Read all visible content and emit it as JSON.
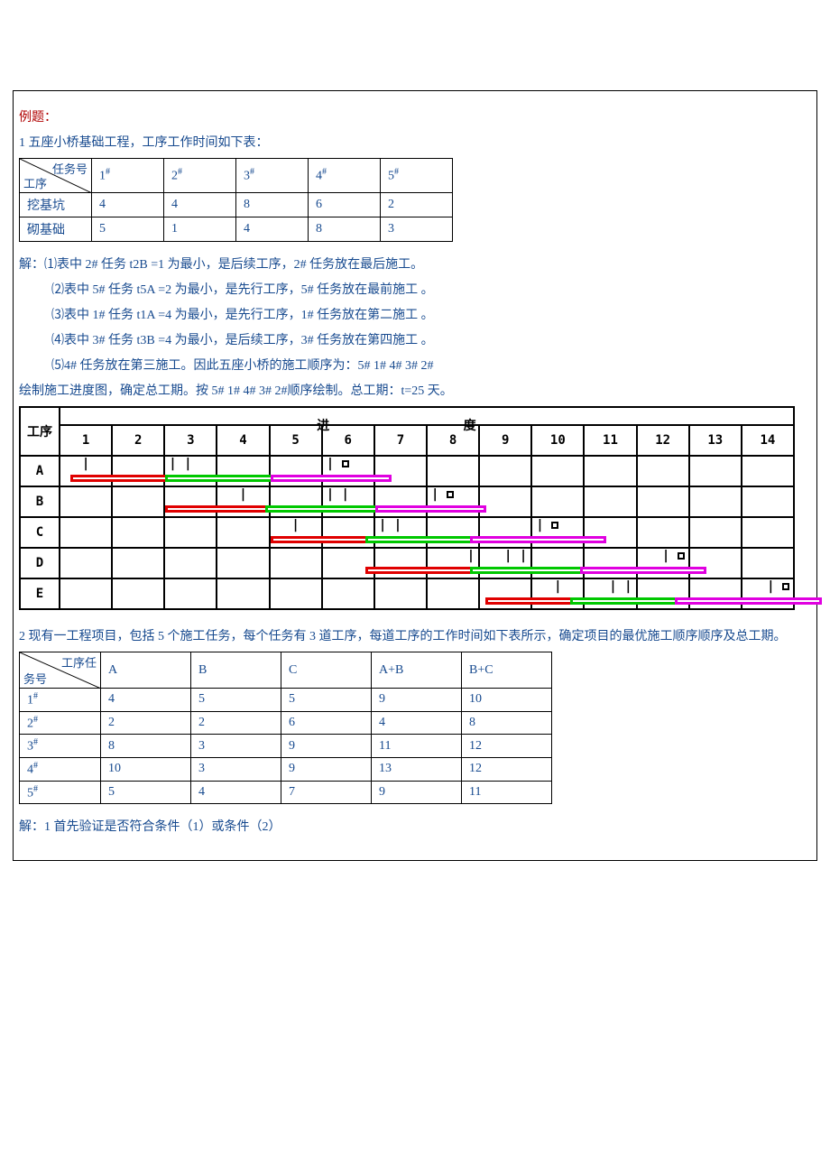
{
  "heading": "例题：",
  "p1_intro": "1 五座小桥基础工程，工序工作时间如下表：",
  "t1": {
    "diag_top": "任务号",
    "diag_bot": "工序",
    "cols": [
      "1",
      "2",
      "3",
      "4",
      "5"
    ],
    "sup": "#",
    "rows": [
      {
        "label": "挖基坑",
        "vals": [
          "4",
          "4",
          "8",
          "6",
          "2"
        ]
      },
      {
        "label": "砌基础",
        "vals": [
          "5",
          "1",
          "4",
          "8",
          "3"
        ]
      }
    ]
  },
  "soln": {
    "s1": "解：⑴表中 2# 任务 t2B =1 为最小，是后续工序，2# 任务放在最后施工。",
    "s2": "⑵表中 5# 任务 t5A =2 为最小，是先行工序，5# 任务放在最前施工 。",
    "s3": "⑶表中 1# 任务 t1A =4 为最小，是先行工序，1# 任务放在第二施工 。",
    "s4": "⑷表中 3# 任务 t3B =4 为最小，是后续工序，3# 任务放在第四施工 。",
    "s5": "⑸4# 任务放在第三施工。因此五座小桥的施工顺序为：5#  1#  4#  3#  2#",
    "s6": "绘制施工进度图，确定总工期。按 5#  1#  4#  3#  2#顺序绘制。总工期：t=25 天。"
  },
  "gantt": {
    "hdr_left": "工序",
    "hdr_mid_a": "进",
    "hdr_mid_b": "度",
    "cols": [
      "1",
      "2",
      "3",
      "4",
      "5",
      "6",
      "7",
      "8",
      "9",
      "10",
      "11",
      "12",
      "13",
      "14"
    ],
    "rows": [
      "A",
      "B",
      "C",
      "D",
      "E"
    ]
  },
  "p2_intro": "2 现有一工程项目，包括 5 个施工任务，每个任务有 3 道工序，每道工序的工作时间如下表所示，确定项目的最优施工顺序顺序及总工期。",
  "t2": {
    "diag_top": "工序任",
    "diag_bot": "务号",
    "cols": [
      "A",
      "B",
      "C",
      "A+B",
      "B+C"
    ],
    "rows": [
      {
        "label": "1",
        "sup": "#",
        "vals": [
          "4",
          "5",
          "5",
          "9",
          "10"
        ]
      },
      {
        "label": "2",
        "sup": "#",
        "vals": [
          "2",
          "2",
          "6",
          "4",
          "8"
        ]
      },
      {
        "label": "3",
        "sup": "#",
        "vals": [
          "8",
          "3",
          "9",
          "11",
          "12"
        ]
      },
      {
        "label": "4",
        "sup": "#",
        "vals": [
          "10",
          "3",
          "9",
          "13",
          "12"
        ]
      },
      {
        "label": "5",
        "sup": "#",
        "vals": [
          "5",
          "4",
          "7",
          "9",
          "11"
        ]
      }
    ]
  },
  "p2_soln": "解：1 首先验证是否符合条件（1）或条件（2）",
  "chart_data": {
    "type": "gantt-like-bar",
    "note": "Schematic construction progress chart with three colored bars per row segment (red/green/magenta) across 14 time columns for rows A–E.",
    "columns": 14,
    "rows": [
      "A",
      "B",
      "C",
      "D",
      "E"
    ]
  }
}
